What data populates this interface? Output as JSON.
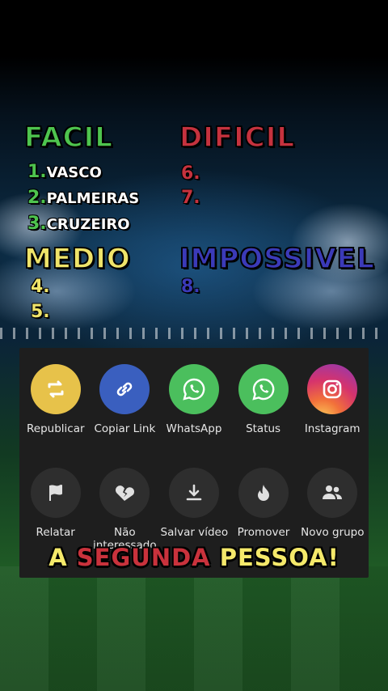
{
  "tiers": {
    "facil": {
      "title": "FACIL",
      "color": "#4ec44e",
      "items": [
        {
          "num": "1.",
          "name": "VASCO"
        },
        {
          "num": "2.",
          "name": "PALMEIRAS"
        },
        {
          "num": "3.",
          "name": "CRUZEIRO"
        }
      ]
    },
    "dificil": {
      "title": "DIFICIL",
      "color": "#c5323e",
      "items": [
        {
          "num": "6.",
          "name": ""
        },
        {
          "num": "7.",
          "name": ""
        }
      ]
    },
    "medio": {
      "title": "MEDIO",
      "color": "#efe46a",
      "items": [
        {
          "num": "4.",
          "name": ""
        },
        {
          "num": "5.",
          "name": ""
        }
      ]
    },
    "impossivel": {
      "title": "IMPOSSIVEL",
      "color": "#3b3ab8",
      "items": [
        {
          "num": "8.",
          "name": ""
        }
      ]
    }
  },
  "share_sheet": {
    "share_targets": [
      {
        "label": "Republicar",
        "icon": "repost-icon",
        "color": "#e7c24a"
      },
      {
        "label": "Copiar Link",
        "icon": "link-icon",
        "color": "#3a5fbf"
      },
      {
        "label": "WhatsApp",
        "icon": "whatsapp-icon",
        "color": "#4bbf5d"
      },
      {
        "label": "Status",
        "icon": "whatsapp-status-icon",
        "color": "#4bbf5d"
      },
      {
        "label": "Instagram",
        "icon": "instagram-icon",
        "color": "#d6336c"
      }
    ],
    "actions": [
      {
        "label": "Relatar",
        "icon": "flag-icon"
      },
      {
        "label": "Não interessado",
        "icon": "broken-heart-icon"
      },
      {
        "label": "Salvar vídeo",
        "icon": "download-icon"
      },
      {
        "label": "Promover",
        "icon": "flame-icon"
      },
      {
        "label": "Novo grupo",
        "icon": "group-icon"
      }
    ]
  },
  "banner": {
    "part1": "A",
    "part2": "SEGUNDA",
    "part3": "PESSOA!"
  }
}
